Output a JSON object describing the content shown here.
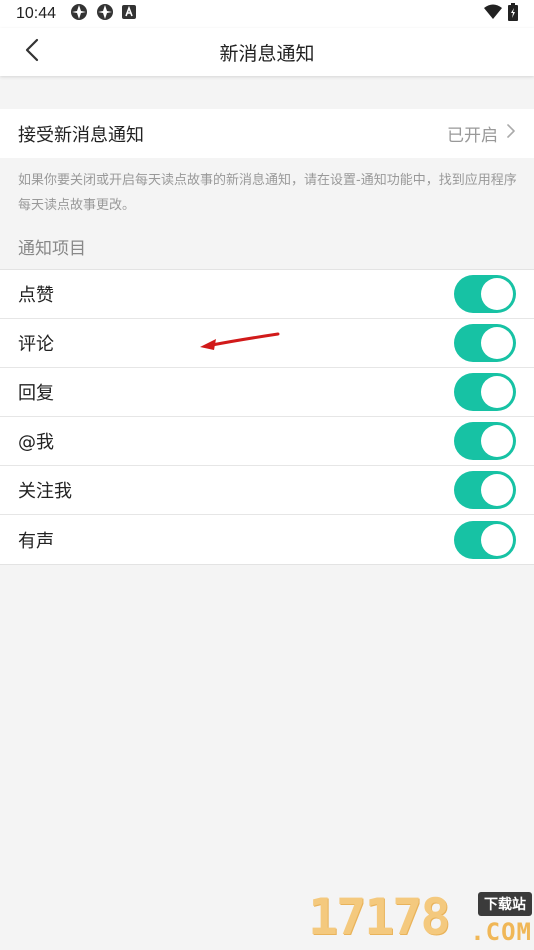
{
  "status_bar": {
    "time": "10:44",
    "icons": [
      "app-icon",
      "app-icon",
      "a-icon"
    ],
    "right_icons": [
      "wifi-icon",
      "battery-icon"
    ]
  },
  "nav": {
    "back_icon": "chevron-left-icon",
    "title": "新消息通知"
  },
  "receive": {
    "label": "接受新消息通知",
    "value": "已开启"
  },
  "hint": "如果你要关闭或开启每天读点故事的新消息通知，请在设置-通知功能中，找到应用程序每天读点故事更改。",
  "section_title": "通知项目",
  "items": [
    {
      "label": "点赞",
      "enabled": true
    },
    {
      "label": "评论",
      "enabled": true
    },
    {
      "label": "回复",
      "enabled": true
    },
    {
      "label": "@我",
      "enabled": true
    },
    {
      "label": "关注我",
      "enabled": true
    },
    {
      "label": "有声",
      "enabled": true
    }
  ],
  "colors": {
    "toggle_on": "#17c2a4",
    "background": "#f4f4f4",
    "annotation_arrow": "#d11a1a"
  },
  "watermark": {
    "digits": "17178",
    "badge": "下载站",
    "suffix": ".COM"
  }
}
